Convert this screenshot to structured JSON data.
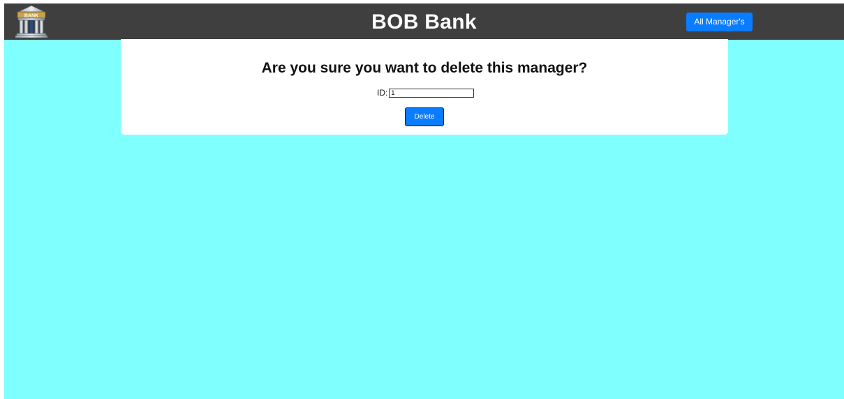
{
  "header": {
    "logo_text": "BANK",
    "brand": "BOB Bank",
    "nav_button_label": "All Manager's"
  },
  "dialog": {
    "title": "Are you sure you want to delete this manager?",
    "id_label": "ID:",
    "id_value": "1",
    "delete_label": "Delete"
  },
  "colors": {
    "page_background": "#80ffff",
    "header_background": "#3f3f3f",
    "button": "#0a7cff",
    "card": "#ffffff"
  },
  "icons": {
    "logo": "bank-building-icon"
  }
}
